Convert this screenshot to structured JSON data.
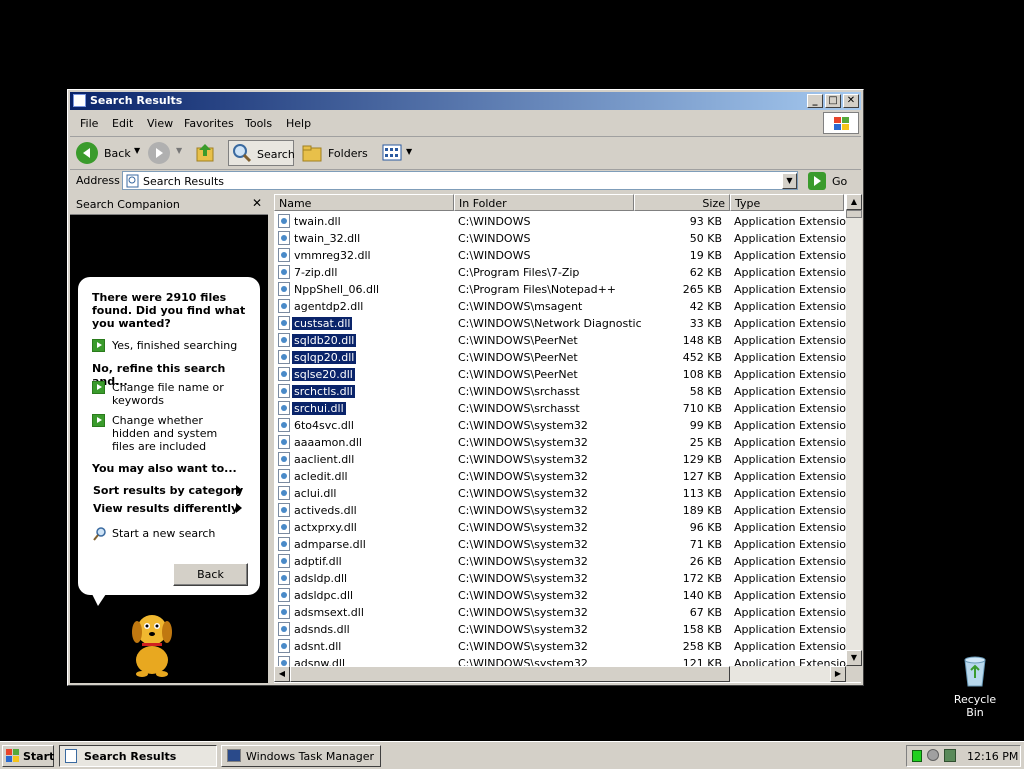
{
  "window": {
    "title": "Search Results"
  },
  "menu": [
    "File",
    "Edit",
    "View",
    "Favorites",
    "Tools",
    "Help"
  ],
  "toolbar": {
    "back": "Back",
    "search": "Search",
    "folders": "Folders"
  },
  "address": {
    "label": "Address",
    "value": "Search Results",
    "go": "Go"
  },
  "companion": {
    "title": "Search Companion",
    "found_text": "There were 2910 files found. Did you find what you wanted?",
    "finished": "Yes, finished searching",
    "refine_heading": "No, refine this search and...",
    "change_name": "Change file name or keywords",
    "change_hidden": "Change whether hidden and system files are included",
    "also_heading": "You may also want to...",
    "sort_by": "Sort results by category",
    "view_diff": "View results differently",
    "new_search": "Start a new search",
    "back": "Back"
  },
  "columns": {
    "name": "Name",
    "folder": "In Folder",
    "size": "Size",
    "type": "Type"
  },
  "rows": [
    {
      "name": "twain.dll",
      "folder": "C:\\WINDOWS",
      "size": "93 KB",
      "type": "Application Extension",
      "selected": false
    },
    {
      "name": "twain_32.dll",
      "folder": "C:\\WINDOWS",
      "size": "50 KB",
      "type": "Application Extension",
      "selected": false
    },
    {
      "name": "vmmreg32.dll",
      "folder": "C:\\WINDOWS",
      "size": "19 KB",
      "type": "Application Extension",
      "selected": false
    },
    {
      "name": "7-zip.dll",
      "folder": "C:\\Program Files\\7-Zip",
      "size": "62 KB",
      "type": "Application Extension",
      "selected": false
    },
    {
      "name": "NppShell_06.dll",
      "folder": "C:\\Program Files\\Notepad++",
      "size": "265 KB",
      "type": "Application Extension",
      "selected": false
    },
    {
      "name": "agentdp2.dll",
      "folder": "C:\\WINDOWS\\msagent",
      "size": "42 KB",
      "type": "Application Extension",
      "selected": false
    },
    {
      "name": "custsat.dll",
      "folder": "C:\\WINDOWS\\Network Diagnostic",
      "size": "33 KB",
      "type": "Application Extension",
      "selected": true
    },
    {
      "name": "sqldb20.dll",
      "folder": "C:\\WINDOWS\\PeerNet",
      "size": "148 KB",
      "type": "Application Extension",
      "selected": true
    },
    {
      "name": "sqlqp20.dll",
      "folder": "C:\\WINDOWS\\PeerNet",
      "size": "452 KB",
      "type": "Application Extension",
      "selected": true
    },
    {
      "name": "sqlse20.dll",
      "folder": "C:\\WINDOWS\\PeerNet",
      "size": "108 KB",
      "type": "Application Extension",
      "selected": true
    },
    {
      "name": "srchctls.dll",
      "folder": "C:\\WINDOWS\\srchasst",
      "size": "58 KB",
      "type": "Application Extension",
      "selected": true
    },
    {
      "name": "srchui.dll",
      "folder": "C:\\WINDOWS\\srchasst",
      "size": "710 KB",
      "type": "Application Extension",
      "selected": true
    },
    {
      "name": "6to4svc.dll",
      "folder": "C:\\WINDOWS\\system32",
      "size": "99 KB",
      "type": "Application Extension",
      "selected": false
    },
    {
      "name": "aaaamon.dll",
      "folder": "C:\\WINDOWS\\system32",
      "size": "25 KB",
      "type": "Application Extension",
      "selected": false
    },
    {
      "name": "aaclient.dll",
      "folder": "C:\\WINDOWS\\system32",
      "size": "129 KB",
      "type": "Application Extension",
      "selected": false
    },
    {
      "name": "acledit.dll",
      "folder": "C:\\WINDOWS\\system32",
      "size": "127 KB",
      "type": "Application Extension",
      "selected": false
    },
    {
      "name": "aclui.dll",
      "folder": "C:\\WINDOWS\\system32",
      "size": "113 KB",
      "type": "Application Extension",
      "selected": false
    },
    {
      "name": "activeds.dll",
      "folder": "C:\\WINDOWS\\system32",
      "size": "189 KB",
      "type": "Application Extension",
      "selected": false
    },
    {
      "name": "actxprxy.dll",
      "folder": "C:\\WINDOWS\\system32",
      "size": "96 KB",
      "type": "Application Extension",
      "selected": false
    },
    {
      "name": "admparse.dll",
      "folder": "C:\\WINDOWS\\system32",
      "size": "71 KB",
      "type": "Application Extension",
      "selected": false
    },
    {
      "name": "adptif.dll",
      "folder": "C:\\WINDOWS\\system32",
      "size": "26 KB",
      "type": "Application Extension",
      "selected": false
    },
    {
      "name": "adsldp.dll",
      "folder": "C:\\WINDOWS\\system32",
      "size": "172 KB",
      "type": "Application Extension",
      "selected": false
    },
    {
      "name": "adsldpc.dll",
      "folder": "C:\\WINDOWS\\system32",
      "size": "140 KB",
      "type": "Application Extension",
      "selected": false
    },
    {
      "name": "adsmsext.dll",
      "folder": "C:\\WINDOWS\\system32",
      "size": "67 KB",
      "type": "Application Extension",
      "selected": false
    },
    {
      "name": "adsnds.dll",
      "folder": "C:\\WINDOWS\\system32",
      "size": "158 KB",
      "type": "Application Extension",
      "selected": false
    },
    {
      "name": "adsnt.dll",
      "folder": "C:\\WINDOWS\\system32",
      "size": "258 KB",
      "type": "Application Extension",
      "selected": false
    },
    {
      "name": "adsnw.dll",
      "folder": "C:\\WINDOWS\\system32",
      "size": "121 KB",
      "type": "Application Extension",
      "selected": false
    }
  ],
  "taskbar": {
    "start": "Start",
    "items": [
      "Search Results",
      "Windows Task Manager"
    ],
    "clock": "12:16 PM"
  },
  "desktop": {
    "recycle_bin": "Recycle Bin"
  }
}
